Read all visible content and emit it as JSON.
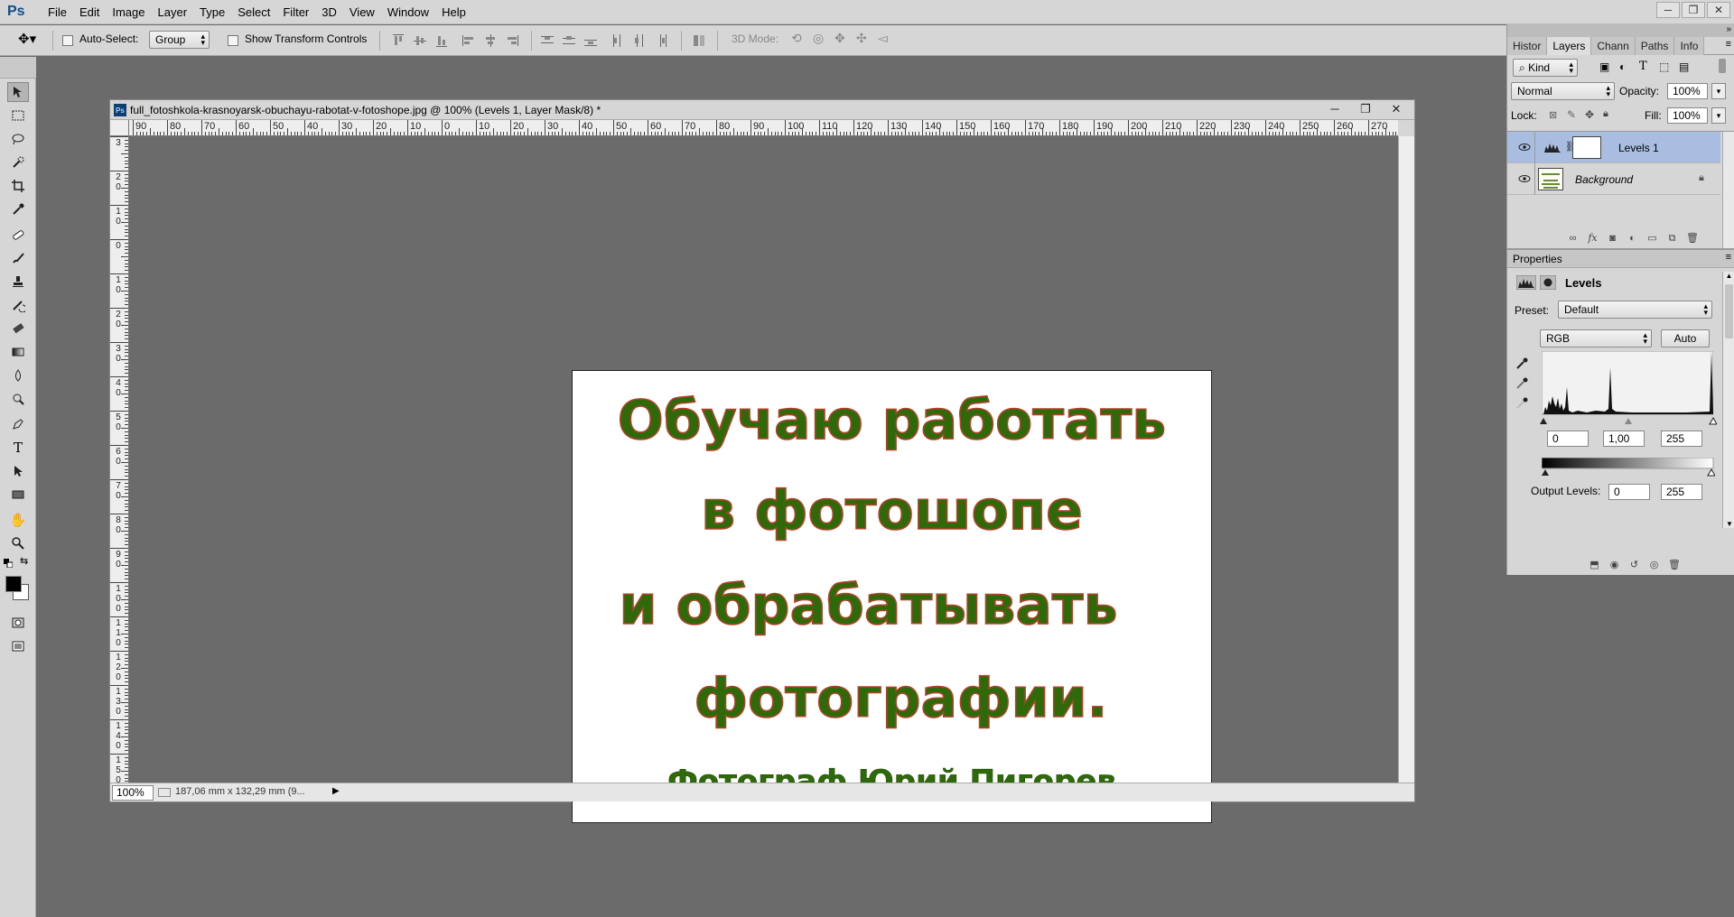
{
  "app": {
    "logo": "Ps"
  },
  "menu": [
    "File",
    "Edit",
    "Image",
    "Layer",
    "Type",
    "Select",
    "Filter",
    "3D",
    "View",
    "Window",
    "Help"
  ],
  "window_controls": {
    "minimize": "─",
    "restore": "❐",
    "close": "✕"
  },
  "options": {
    "auto_select_label": "Auto-Select:",
    "auto_select_value": "Group",
    "show_transform_label": "Show Transform Controls",
    "mode_3d_label": "3D Mode:"
  },
  "document": {
    "title": "full_fotoshkola-krasnoyarsk-obuchayu-rabotat-v-fotoshope.jpg @ 100% (Levels 1, Layer Mask/8) *",
    "zoom": "100%",
    "doc_size": "187,06 mm x 132,29 mm (9...",
    "ruler_top": [
      "90",
      "80",
      "70",
      "60",
      "50",
      "40",
      "30",
      "20",
      "10",
      "0",
      "10",
      "20",
      "30",
      "40",
      "50",
      "60",
      "70",
      "80",
      "90",
      "100",
      "110",
      "120",
      "130",
      "140",
      "150",
      "160",
      "170",
      "180",
      "190",
      "200",
      "210",
      "220",
      "230",
      "240",
      "250",
      "260",
      "270"
    ],
    "ruler_left": [
      "3",
      "2 0",
      "1 0",
      "0",
      "1 0",
      "2 0",
      "3 0",
      "4 0",
      "5 0",
      "6 0",
      "7 0",
      "8 0",
      "9 0",
      "1 0 0",
      "1 1 0",
      "1 2 0",
      "1 3 0",
      "1 4 0",
      "1 5 0"
    ],
    "image_lines": [
      "Обучаю работать",
      "в фотошопе",
      "и обрабатывать",
      "фотографии.",
      "Фотограф Юрий Пигорев"
    ]
  },
  "layers_panel": {
    "tabs": [
      "Histor",
      "Layers",
      "Chann",
      "Paths",
      "Info"
    ],
    "active_tab": "Layers",
    "filter_kind": "Kind",
    "blend_mode": "Normal",
    "opacity_label": "Opacity:",
    "opacity_value": "100%",
    "lock_label": "Lock:",
    "fill_label": "Fill:",
    "fill_value": "100%",
    "layers": [
      {
        "name": "Levels 1",
        "selected": true
      },
      {
        "name": "Background",
        "selected": false
      }
    ]
  },
  "properties_panel": {
    "title": "Properties",
    "adjustment": "Levels",
    "preset_label": "Preset:",
    "preset_value": "Default",
    "channel": "RGB",
    "auto_label": "Auto",
    "input_black": "0",
    "input_gamma": "1,00",
    "input_white": "255",
    "output_label": "Output Levels:",
    "output_black": "0",
    "output_white": "255"
  },
  "colors": {
    "text_green": "#2f6a0a",
    "text_outline": "#b7412a",
    "selected_layer": "#a8bde0",
    "canvas_bg": "#6b6b6b"
  }
}
